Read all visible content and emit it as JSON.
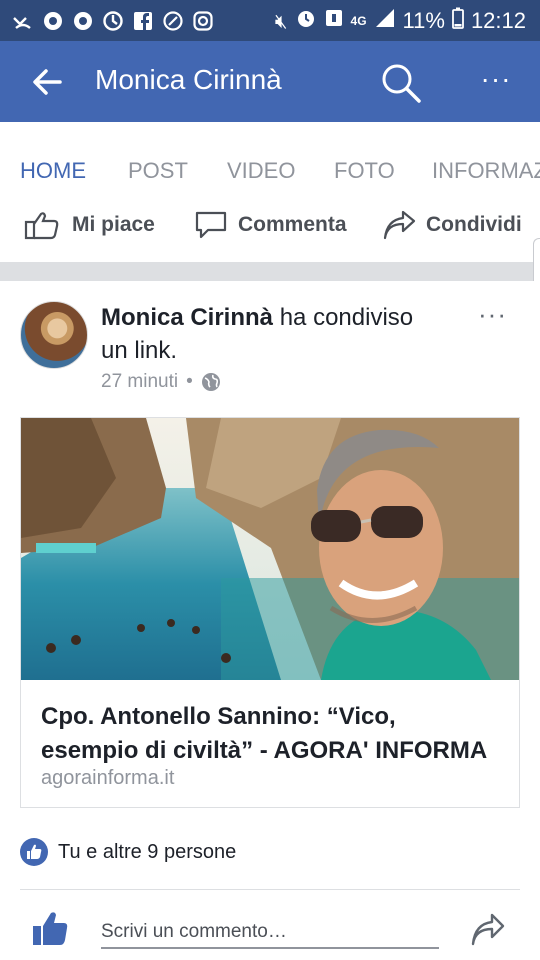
{
  "status_bar": {
    "left_icons": [
      "missed-call-icon",
      "chrome-icon",
      "chrome-icon",
      "sync-icon",
      "facebook-icon",
      "whatsapp-icon",
      "instagram-icon"
    ],
    "network": "4G",
    "battery": "11%",
    "time": "12:12"
  },
  "appbar": {
    "title": "Monica Cirinnà",
    "more": "···"
  },
  "tabs": [
    {
      "label": "HOME"
    },
    {
      "label": "POST"
    },
    {
      "label": "VIDEO"
    },
    {
      "label": "FOTO"
    },
    {
      "label": "INFORMAZ"
    }
  ],
  "actions": {
    "like": "Mi piace",
    "comment": "Commenta",
    "share": "Condividi"
  },
  "post": {
    "author": "Monica Cirinnà",
    "action_text": " ha condiviso un link.",
    "time": "27 minuti",
    "visibility_sep": "•",
    "more": "···",
    "link": {
      "title_line1": "Cpo. Antonello Sannino: “Vico,",
      "title_line2": "esempio di civiltà” - AGORA' INFORMA",
      "domain": "agorainforma.it"
    },
    "reactions": "Tu e altre 9 persone",
    "comment_placeholder": "Scrivi un commento…"
  },
  "colors": {
    "status_bar": "#2f4a7a",
    "brand": "#4267b2",
    "muted": "#90949c"
  }
}
